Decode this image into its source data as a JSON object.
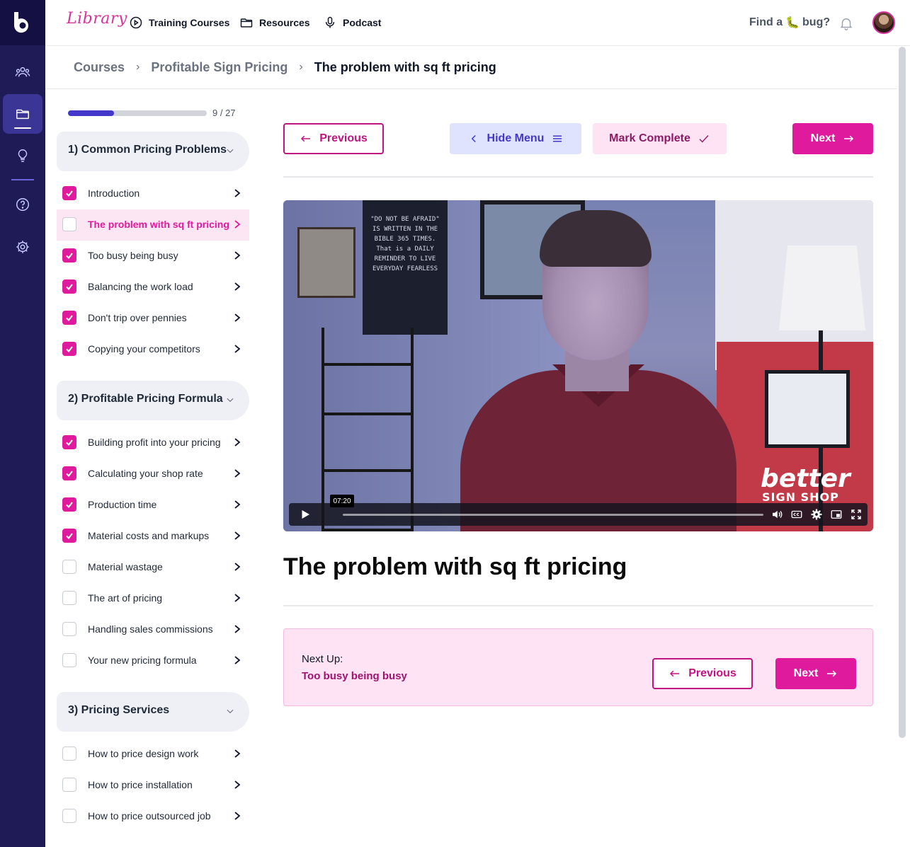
{
  "app": {
    "logo_letter": "b",
    "library_logo_text": "Library"
  },
  "nav": {
    "items": [
      {
        "label": "Training Courses",
        "icon": "play-circle-icon"
      },
      {
        "label": "Resources",
        "icon": "folder-icon"
      },
      {
        "label": "Podcast",
        "icon": "microphone-icon"
      }
    ],
    "find_bug_prefix": "Find a",
    "find_bug_emoji": "🐛",
    "find_bug_suffix": "bug?"
  },
  "rail": {
    "items": [
      {
        "icon": "users-icon",
        "active": false
      },
      {
        "icon": "folder-icon",
        "active": true
      },
      {
        "icon": "lightbulb-icon",
        "active": false
      },
      {
        "icon": "help-circle-icon",
        "active": false
      },
      {
        "icon": "gear-icon",
        "active": false
      }
    ]
  },
  "breadcrumb": {
    "items": [
      "Courses",
      "Profitable Sign Pricing",
      "The problem with sq ft pricing"
    ]
  },
  "progress": {
    "current": 9,
    "total": 27,
    "label": "9 / 27"
  },
  "sections": [
    {
      "title": "1) Common Pricing Problems",
      "lessons": [
        {
          "label": "Introduction",
          "done": true
        },
        {
          "label": "The problem with sq ft pricing",
          "done": false,
          "active": true
        },
        {
          "label": "Too busy being busy",
          "done": true
        },
        {
          "label": "Balancing the work load",
          "done": true
        },
        {
          "label": "Don't trip over pennies",
          "done": true
        },
        {
          "label": "Copying your competitors",
          "done": true
        }
      ]
    },
    {
      "title": "2) Profitable Pricing Formula",
      "lessons": [
        {
          "label": "Building profit into your pricing",
          "done": true
        },
        {
          "label": "Calculating your shop rate",
          "done": true
        },
        {
          "label": "Production time",
          "done": true
        },
        {
          "label": "Material costs and markups",
          "done": true
        },
        {
          "label": "Material wastage",
          "done": false
        },
        {
          "label": "The art of pricing",
          "done": false
        },
        {
          "label": "Handling sales commissions",
          "done": false
        },
        {
          "label": "Your new pricing formula",
          "done": false
        }
      ]
    },
    {
      "title": "3) Pricing Services",
      "lessons": [
        {
          "label": "How to price design work",
          "done": false
        },
        {
          "label": "How to price installation",
          "done": false
        },
        {
          "label": "How to price outsourced job",
          "done": false
        }
      ]
    }
  ],
  "actions": {
    "previous": "Previous",
    "hide_menu": "Hide Menu",
    "mark_complete": "Mark Complete",
    "next": "Next"
  },
  "video": {
    "time_tooltip": "07:20",
    "watermark_line1": "better",
    "watermark_line2": "SIGN SHOP",
    "poster_text": "\"DO NOT BE AFRAID\" IS WRITTEN IN THE BIBLE 365 TIMES. That is a DAILY REMINDER TO LIVE EVERYDAY FEARLESS"
  },
  "lesson_title": "The problem with sq ft pricing",
  "next_up": {
    "label": "Next Up:",
    "lesson": "Too busy being busy",
    "previous": "Previous",
    "next": "Next"
  },
  "colors": {
    "accent": "#e01a9c",
    "rail_bg": "#1f1b57",
    "progress": "#4338ca"
  }
}
